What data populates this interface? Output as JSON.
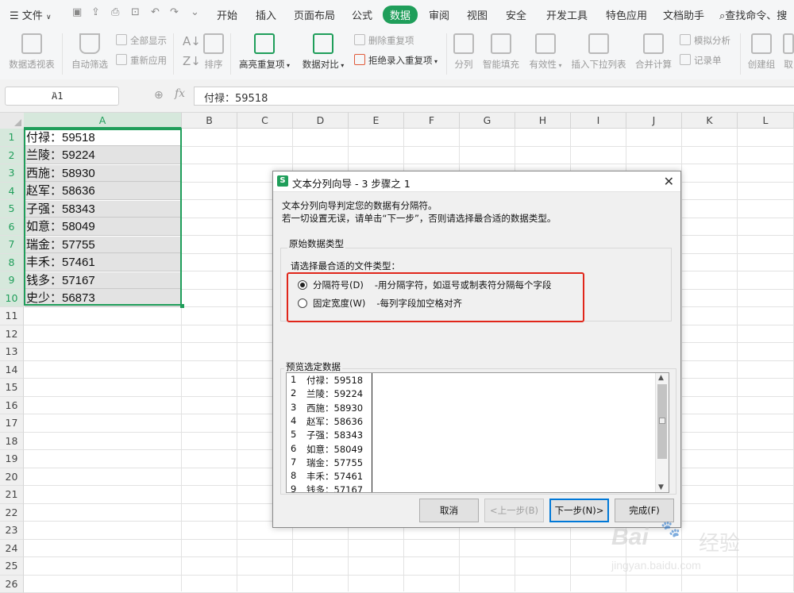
{
  "menu": {
    "file_label": "文件",
    "tabs": [
      "开始",
      "插入",
      "页面布局",
      "公式",
      "数据",
      "审阅",
      "视图",
      "安全",
      "开发工具",
      "特色应用",
      "文档助手"
    ],
    "active_tab": "数据",
    "search_label": "查找命令、搜"
  },
  "ribbon": {
    "pivot": "数据透视表",
    "autofilter": "自动筛选",
    "show_all": "全部显示",
    "reapply": "重新应用",
    "sort": "排序",
    "highlight_dup": "高亮重复项",
    "compare": "数据对比",
    "delete_dup": "删除重复项",
    "reject_dup": "拒绝录入重复项",
    "split": "分列",
    "smart_fill": "智能填充",
    "validity": "有效性",
    "dropdown": "插入下拉列表",
    "consolidate": "合并计算",
    "simulate": "模拟分析",
    "record": "记录单",
    "create_group": "创建组",
    "cancel_group": "取"
  },
  "formula_bar": {
    "name_box": "A1",
    "fx": "fx",
    "content": "付禄：59518"
  },
  "sheet": {
    "columns": [
      "A",
      "B",
      "C",
      "D",
      "E",
      "F",
      "G",
      "H",
      "I",
      "J",
      "K",
      "L"
    ],
    "rows": [
      "1",
      "2",
      "3",
      "4",
      "5",
      "6",
      "7",
      "8",
      "9",
      "10",
      "11",
      "12",
      "13",
      "14",
      "15",
      "16",
      "17",
      "18",
      "19",
      "20",
      "21",
      "22",
      "23",
      "24",
      "25",
      "26"
    ],
    "cells": [
      "付禄：59518",
      "兰陵：59224",
      "西施：58930",
      "赵军：58636",
      "子强：58343",
      "如意：58049",
      "瑞金：57755",
      "丰禾：57461",
      "钱多：57167",
      "史少：56873"
    ]
  },
  "dialog": {
    "title": "文本分列向导 - 3 步骤之 1",
    "logo": "S",
    "intro1": "文本分列向导判定您的数据有分隔符。",
    "intro2": "若一切设置无误，请单击“下一步”，否则请选择最合适的数据类型。",
    "group_label": "原始数据类型",
    "choose_label": "请选择最合适的文件类型：",
    "option_delimited": "分隔符号(D)",
    "option_delimited_desc": "-用分隔字符，如逗号或制表符分隔每个字段",
    "option_fixed": "固定宽度(W)",
    "option_fixed_desc": "-每列字段加空格对齐",
    "preview_label": "预览选定数据",
    "preview_rows": [
      {
        "n": "1",
        "t": "付禄：59518"
      },
      {
        "n": "2",
        "t": "兰陵：59224"
      },
      {
        "n": "3",
        "t": "西施：58930"
      },
      {
        "n": "4",
        "t": "赵军：58636"
      },
      {
        "n": "5",
        "t": "子强：58343"
      },
      {
        "n": "6",
        "t": "如意：58049"
      },
      {
        "n": "7",
        "t": "瑞金：57755"
      },
      {
        "n": "8",
        "t": "丰禾：57461"
      },
      {
        "n": "9",
        "t": "钱多：57167"
      }
    ],
    "buttons": {
      "cancel": "取消",
      "back": "<上一步(B)",
      "next": "下一步(N)>",
      "finish": "完成(F)"
    }
  },
  "watermark": {
    "brand": "Bai",
    "brand2": "经验",
    "url": "jingyan.baidu.com"
  },
  "colors": {
    "accent": "#1f9e5a",
    "highlight_border": "#e0261a",
    "primary_button": "#0078d7"
  }
}
